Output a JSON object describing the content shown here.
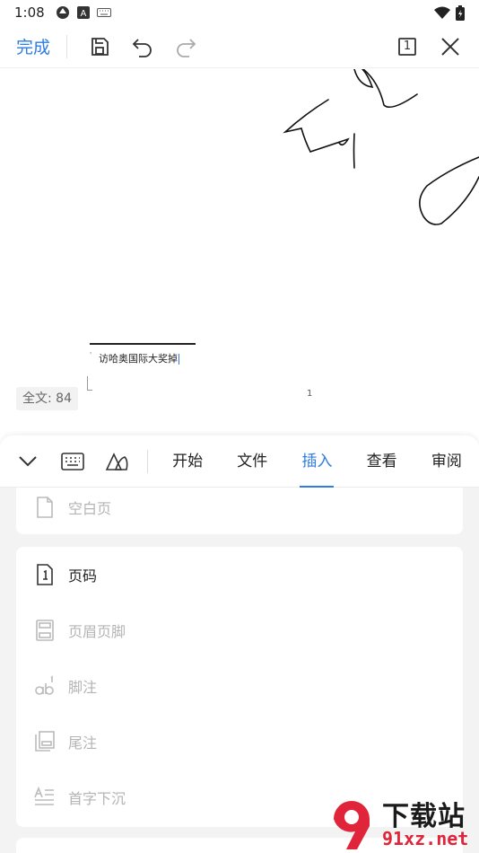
{
  "status_bar": {
    "time": "1:08",
    "icons": [
      "vpn-icon",
      "a-badge-icon",
      "keyboard-icon"
    ],
    "right_icons": [
      "wifi-icon",
      "battery-icon"
    ]
  },
  "toolbar": {
    "done_label": "完成",
    "actions": [
      "save-icon",
      "undo-icon",
      "redo-icon"
    ],
    "page_indicator": "1",
    "close": "close-icon"
  },
  "document": {
    "text": "访哈奥国际大奖掉",
    "word_count": "全文: 84",
    "page_number": "1"
  },
  "panel": {
    "tabs": [
      {
        "label": "开始",
        "active": false
      },
      {
        "label": "文件",
        "active": false
      },
      {
        "label": "插入",
        "active": true
      },
      {
        "label": "查看",
        "active": false
      },
      {
        "label": "审阅",
        "active": false
      }
    ],
    "section1": [
      {
        "label": "空白页",
        "icon": "blank-page-icon",
        "enabled": false
      }
    ],
    "section2": [
      {
        "label": "页码",
        "icon": "page-number-icon",
        "enabled": true
      },
      {
        "label": "页眉页脚",
        "icon": "header-footer-icon",
        "enabled": false
      },
      {
        "label": "脚注",
        "icon": "footnote-icon",
        "enabled": false
      },
      {
        "label": "尾注",
        "icon": "endnote-icon",
        "enabled": false
      },
      {
        "label": "首字下沉",
        "icon": "drop-cap-icon",
        "enabled": false
      }
    ]
  },
  "watermark": {
    "title": "下载站",
    "url": "91xz.net"
  },
  "colors": {
    "accent": "#2f7de1",
    "disabled_text": "#b4b4b4",
    "panel_bg": "#f3f3f3",
    "watermark_red": "#e0243a"
  }
}
